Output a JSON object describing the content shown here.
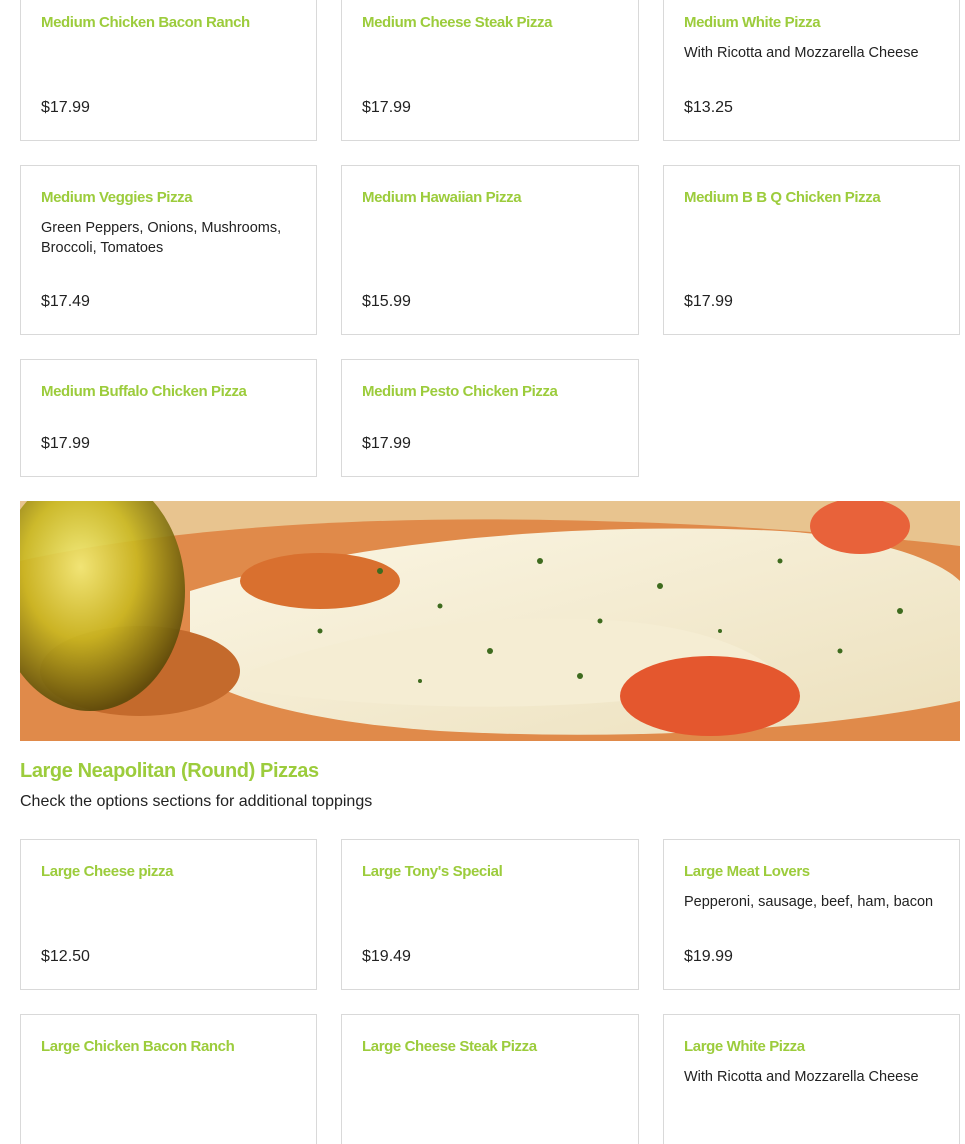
{
  "medium_items": [
    {
      "name": "Medium Chicken Bacon Ranch",
      "desc": "",
      "price": "$17.99"
    },
    {
      "name": "Medium Cheese Steak Pizza",
      "desc": "",
      "price": "$17.99"
    },
    {
      "name": "Medium White Pizza",
      "desc": "With Ricotta and Mozzarella Cheese",
      "price": "$13.25"
    },
    {
      "name": "Medium Veggies Pizza",
      "desc": "Green Peppers, Onions, Mushrooms, Broccoli, Tomatoes",
      "price": "$17.49"
    },
    {
      "name": "Medium Hawaiian Pizza",
      "desc": "",
      "price": "$15.99"
    },
    {
      "name": "Medium B B Q Chicken Pizza",
      "desc": "",
      "price": "$17.99"
    },
    {
      "name": "Medium Buffalo Chicken Pizza",
      "desc": "",
      "price": "$17.99"
    },
    {
      "name": "Medium Pesto Chicken Pizza",
      "desc": "",
      "price": "$17.99"
    }
  ],
  "large_section": {
    "title": "Large Neapolitan (Round) Pizzas",
    "description": "Check the options sections for additional toppings"
  },
  "large_items": [
    {
      "name": "Large Cheese pizza",
      "desc": "",
      "price": "$12.50"
    },
    {
      "name": "Large Tony's Special",
      "desc": "",
      "price": "$19.49"
    },
    {
      "name": "Large Meat Lovers",
      "desc": "Pepperoni, sausage, beef, ham, bacon",
      "price": "$19.99"
    },
    {
      "name": "Large Chicken Bacon Ranch",
      "desc": ""
    },
    {
      "name": "Large Cheese Steak Pizza",
      "desc": ""
    },
    {
      "name": "Large White Pizza",
      "desc": "With Ricotta and Mozzarella Cheese"
    }
  ],
  "colors": {
    "accent": "#9ccc3c",
    "text": "#222222",
    "border": "#d9d9d9"
  }
}
